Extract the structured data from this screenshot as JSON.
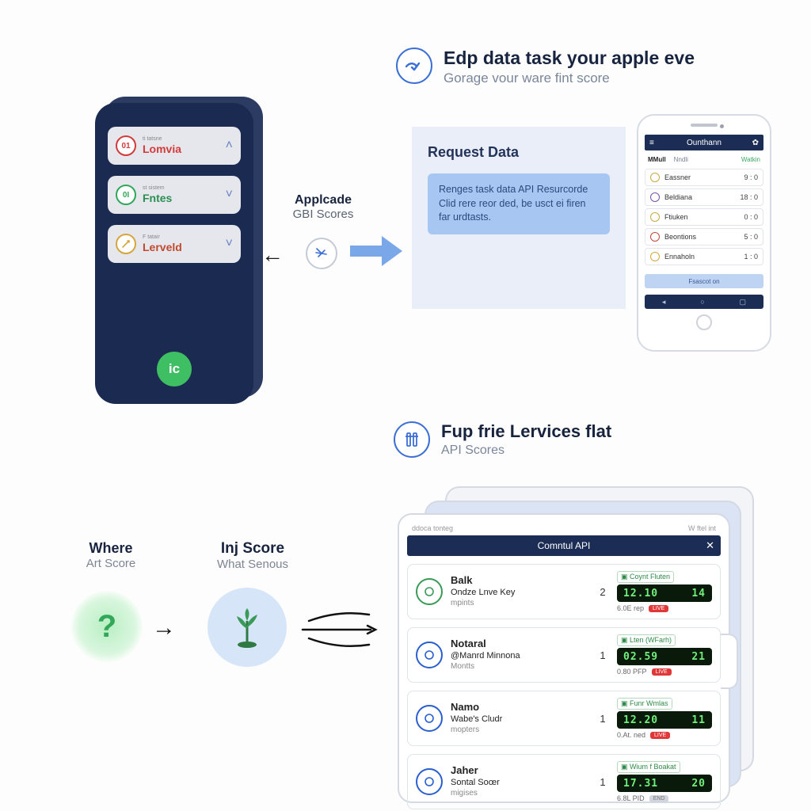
{
  "header1": {
    "title": "Edp data task your apple eve",
    "sub": "Gorage vour ware fint score"
  },
  "midlabel": {
    "t1": "Applcade",
    "t2": "GBI Scores"
  },
  "phoneDark": {
    "items": [
      {
        "tiny": "ti tatsne",
        "label": "Lomvia",
        "color": "#d43a3a",
        "chev": "˄"
      },
      {
        "tiny": "st sistem",
        "label": "Fntes",
        "color": "#2fa85a",
        "chev": "˅"
      },
      {
        "tiny": "F tatair",
        "label": "Lerveld",
        "color": "#d6a53c",
        "chev": "˅"
      }
    ],
    "badge": "ic"
  },
  "request": {
    "title": "Request Data",
    "body": "Renges task data API Resurcorde Clid rere reor ded, be usct ei firen far urdtasts."
  },
  "phoneRight": {
    "header": "Ounthann",
    "gear": "✿",
    "tabs": [
      "MMull",
      "Nndli",
      "Watkin"
    ],
    "rows": [
      {
        "name": "Eassner",
        "score": "9 : 0"
      },
      {
        "name": "Beldiana",
        "score": "18 : 0"
      },
      {
        "name": "Ftiuken",
        "score": "0 : 0"
      },
      {
        "name": "Beontions",
        "score": "5 : 0"
      },
      {
        "name": "Ennaholn",
        "score": "1 : 0"
      }
    ],
    "cta": "Fsascot on"
  },
  "header2": {
    "title": "Fup frie Lervices flat",
    "sub": "API Scores"
  },
  "where": {
    "t1": "Where",
    "t2": "Art Score"
  },
  "inj": {
    "t1": "Inj Score",
    "t2": "What Senous"
  },
  "tablet": {
    "topleft": "ddoca tonteg",
    "topright": "W ftel int",
    "title": "Comntul API",
    "rows": [
      {
        "name": "Balk",
        "sub": "Ondze Lnve Key",
        "sub2": "mpints",
        "n": "2",
        "tag": "Coynt Fluten",
        "score": "12.10   14",
        "under": "6.0E rep",
        "live": true,
        "col": "#3a9a58"
      },
      {
        "name": "Notaral",
        "sub": "@Manrd Minnona",
        "sub2": "Montts",
        "n": "1",
        "tag": "Lten (WFarh)",
        "score": "02.59   21",
        "under": "0.80 PFP",
        "live": true,
        "col": "#2a5fd0"
      },
      {
        "name": "Namo",
        "sub": "Wabe's Cludr",
        "sub2": "mopters",
        "n": "1",
        "tag": "Funr Wmlas",
        "score": "12.20   11",
        "under": "0.At. ned",
        "live": true,
        "col": "#2a5fd0"
      },
      {
        "name": "Jaher",
        "sub": "Sontal Soœr",
        "sub2": "migises",
        "n": "1",
        "tag": "Wium f Boakat",
        "score": "17.31   20",
        "under": "6.8L PID",
        "live": false,
        "col": "#2a5fd0"
      }
    ]
  }
}
